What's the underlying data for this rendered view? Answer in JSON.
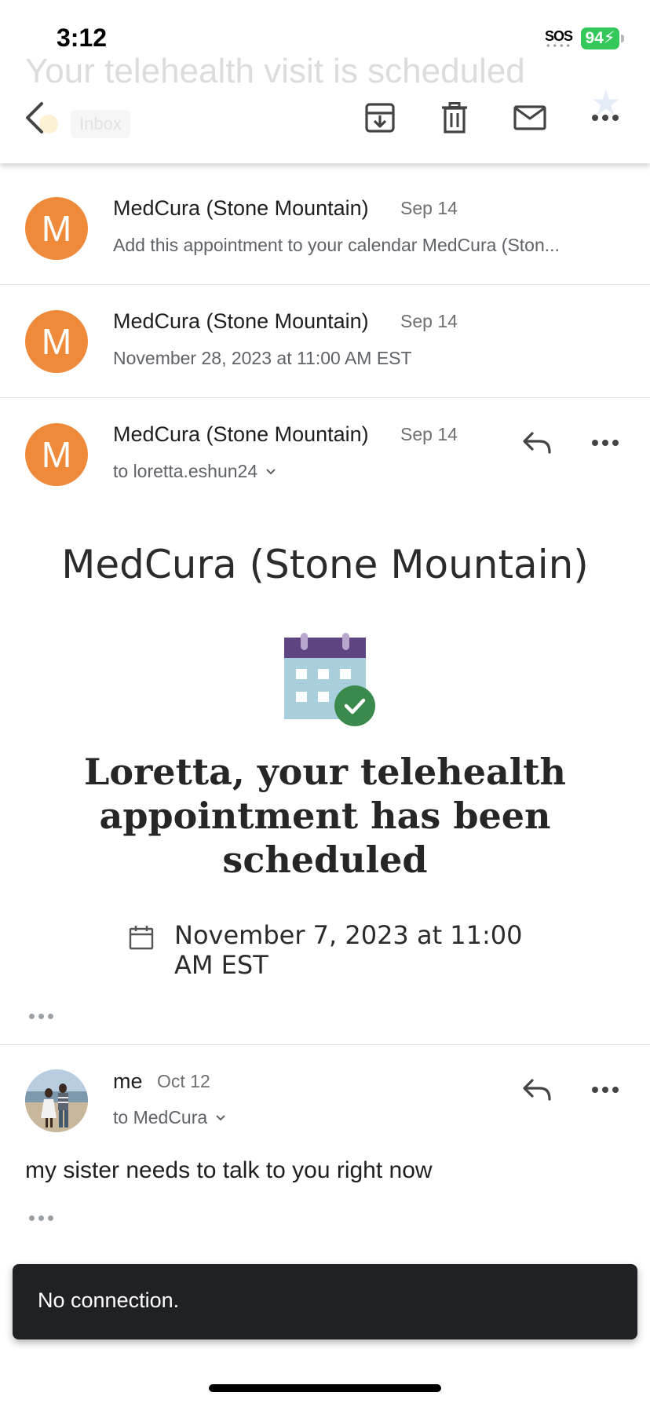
{
  "status_bar": {
    "time": "3:12",
    "sos": "SOS",
    "battery": "94"
  },
  "thread": {
    "subject": "Your telehealth visit is scheduled",
    "label": "Inbox"
  },
  "toolbar": {
    "back_icon": "chevron-left-icon",
    "archive_icon": "archive-icon",
    "delete_icon": "trash-icon",
    "unread_icon": "mail-icon",
    "more_icon": "more-icon"
  },
  "messages": [
    {
      "initial": "M",
      "sender": "MedCura (Stone Mountain)",
      "date": "Sep 14",
      "snippet": "Add this appointment to your calendar MedCura (Ston..."
    },
    {
      "initial": "M",
      "sender": "MedCura (Stone Mountain)",
      "date": "Sep 14",
      "snippet": "November 28, 2023 at 11:00 AM EST"
    },
    {
      "initial": "M",
      "sender": "MedCura (Stone Mountain)",
      "date": "Sep 14",
      "recipient": "to loretta.eshun24"
    }
  ],
  "email_body": {
    "brand": "MedCura (Stone Mountain)",
    "headline": "Loretta, your telehealth appointment has been scheduled",
    "appointment_date": "November 7, 2023 at 11:00 AM EST"
  },
  "reply": {
    "sender": "me",
    "date": "Oct 12",
    "recipient": "to MedCura",
    "body": "my sister needs to talk to you right now"
  },
  "snackbar": {
    "text": "No connection."
  },
  "colors": {
    "avatar": "#ef8a3a",
    "calendar_header": "#5e4582",
    "calendar_body": "#a9cfdc",
    "check_badge": "#3b8a4d",
    "snackbar_bg": "#202124",
    "battery": "#34c759"
  }
}
